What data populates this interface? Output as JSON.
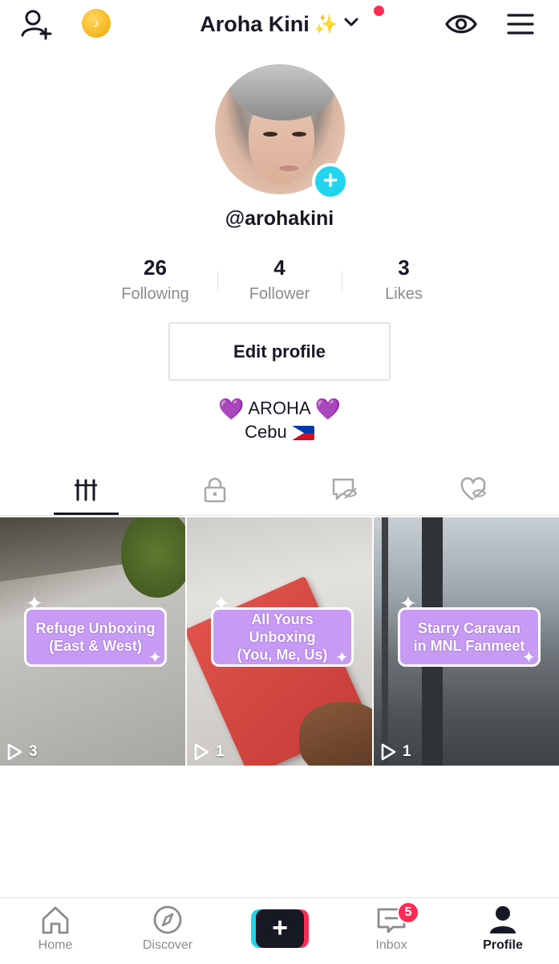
{
  "header": {
    "title": "Aroha Kini",
    "title_emoji": "✨",
    "coin_symbol": "♪",
    "icons": [
      "add-user-icon",
      "coin-icon",
      "chevron-down-icon",
      "eye-icon",
      "menu-icon"
    ]
  },
  "profile": {
    "username": "@arohakini",
    "stats": [
      {
        "value": "26",
        "label": "Following"
      },
      {
        "value": "4",
        "label": "Follower"
      },
      {
        "value": "3",
        "label": "Likes"
      }
    ],
    "edit_button": "Edit profile",
    "bio_line1": "AROHA",
    "bio_heart": "💜",
    "bio_line2": "Cebu"
  },
  "tabs": [
    {
      "icon": "videos-grid-icon",
      "active": true
    },
    {
      "icon": "lock-icon",
      "active": false
    },
    {
      "icon": "hidden-tag-icon",
      "active": false
    },
    {
      "icon": "hidden-heart-icon",
      "active": false
    }
  ],
  "videos": [
    {
      "caption_line1": "Refuge Unboxing",
      "caption_line2": "(East & West)",
      "plays": "3"
    },
    {
      "caption_line1": "All Yours Unboxing",
      "caption_line2": "(You, Me, Us)",
      "plays": "1"
    },
    {
      "caption_line1": "Starry Caravan",
      "caption_line2": "in MNL Fanmeet",
      "plays": "1"
    }
  ],
  "bottom_nav": {
    "home": "Home",
    "discover": "Discover",
    "create": "+",
    "inbox": "Inbox",
    "inbox_badge": "5",
    "profile": "Profile"
  },
  "colors": {
    "accent_red": "#fe2c55",
    "accent_cyan": "#20d5ec",
    "sticker_purple": "#c79bf3",
    "text_primary": "#161823",
    "text_secondary": "#8a8b91"
  }
}
